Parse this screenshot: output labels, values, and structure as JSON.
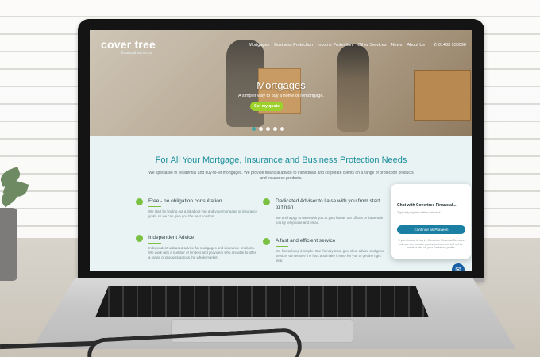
{
  "site": {
    "logo": "cover tree",
    "logo_sub": "financial services",
    "nav": [
      "Mortgages",
      "Business Protection",
      "Income Protection",
      "Other Services",
      "News",
      "About Us"
    ],
    "phone": "01483 930090",
    "hero_title": "Mortgages",
    "hero_sub": "A simpler way to buy a home or remortgage.",
    "cta": "Get my quote",
    "section_title": "For All Your Mortgage, Insurance and Business Protection Needs",
    "lead": "We specialise in residential and buy-to-let mortgages. We provide financial advice to individuals and corporate clients on a range of protection products and insurance products.",
    "features": [
      {
        "title": "Free - no obligation consultation",
        "text": "We start by finding out a bit about you and your mortgage or insurance goals so we can give you the best solution."
      },
      {
        "title": "Dedicated Adviser to liaise with you from start to finish",
        "text": "We are happy to meet with you at your home, our offices or liaise with you by telephone and email."
      },
      {
        "title": "Independent Advice",
        "text": "Independent unbiased advice for mortgages and insurance products. We work with a number of lenders and providers who are able to offer a range of products across the whole market."
      },
      {
        "title": "A fast and efficient service",
        "text": "We like to keep it simple. Our friendly team give clear advice and great service; we remove the fuss and make it easy for you to get the right deal."
      }
    ]
  },
  "chat": {
    "title": "Chat with Covertree Financial...",
    "subtitle": "Typically replies within minutes",
    "button": "Continue as Praveen",
    "note": "If you choose to log in, Covertree Financial Services will see the website you came from and will not be made public on your Facebook profile."
  },
  "colors": {
    "accent": "#1a8e9b",
    "cta_green": "#9bd12a",
    "messenger": "#1a5fa3"
  }
}
